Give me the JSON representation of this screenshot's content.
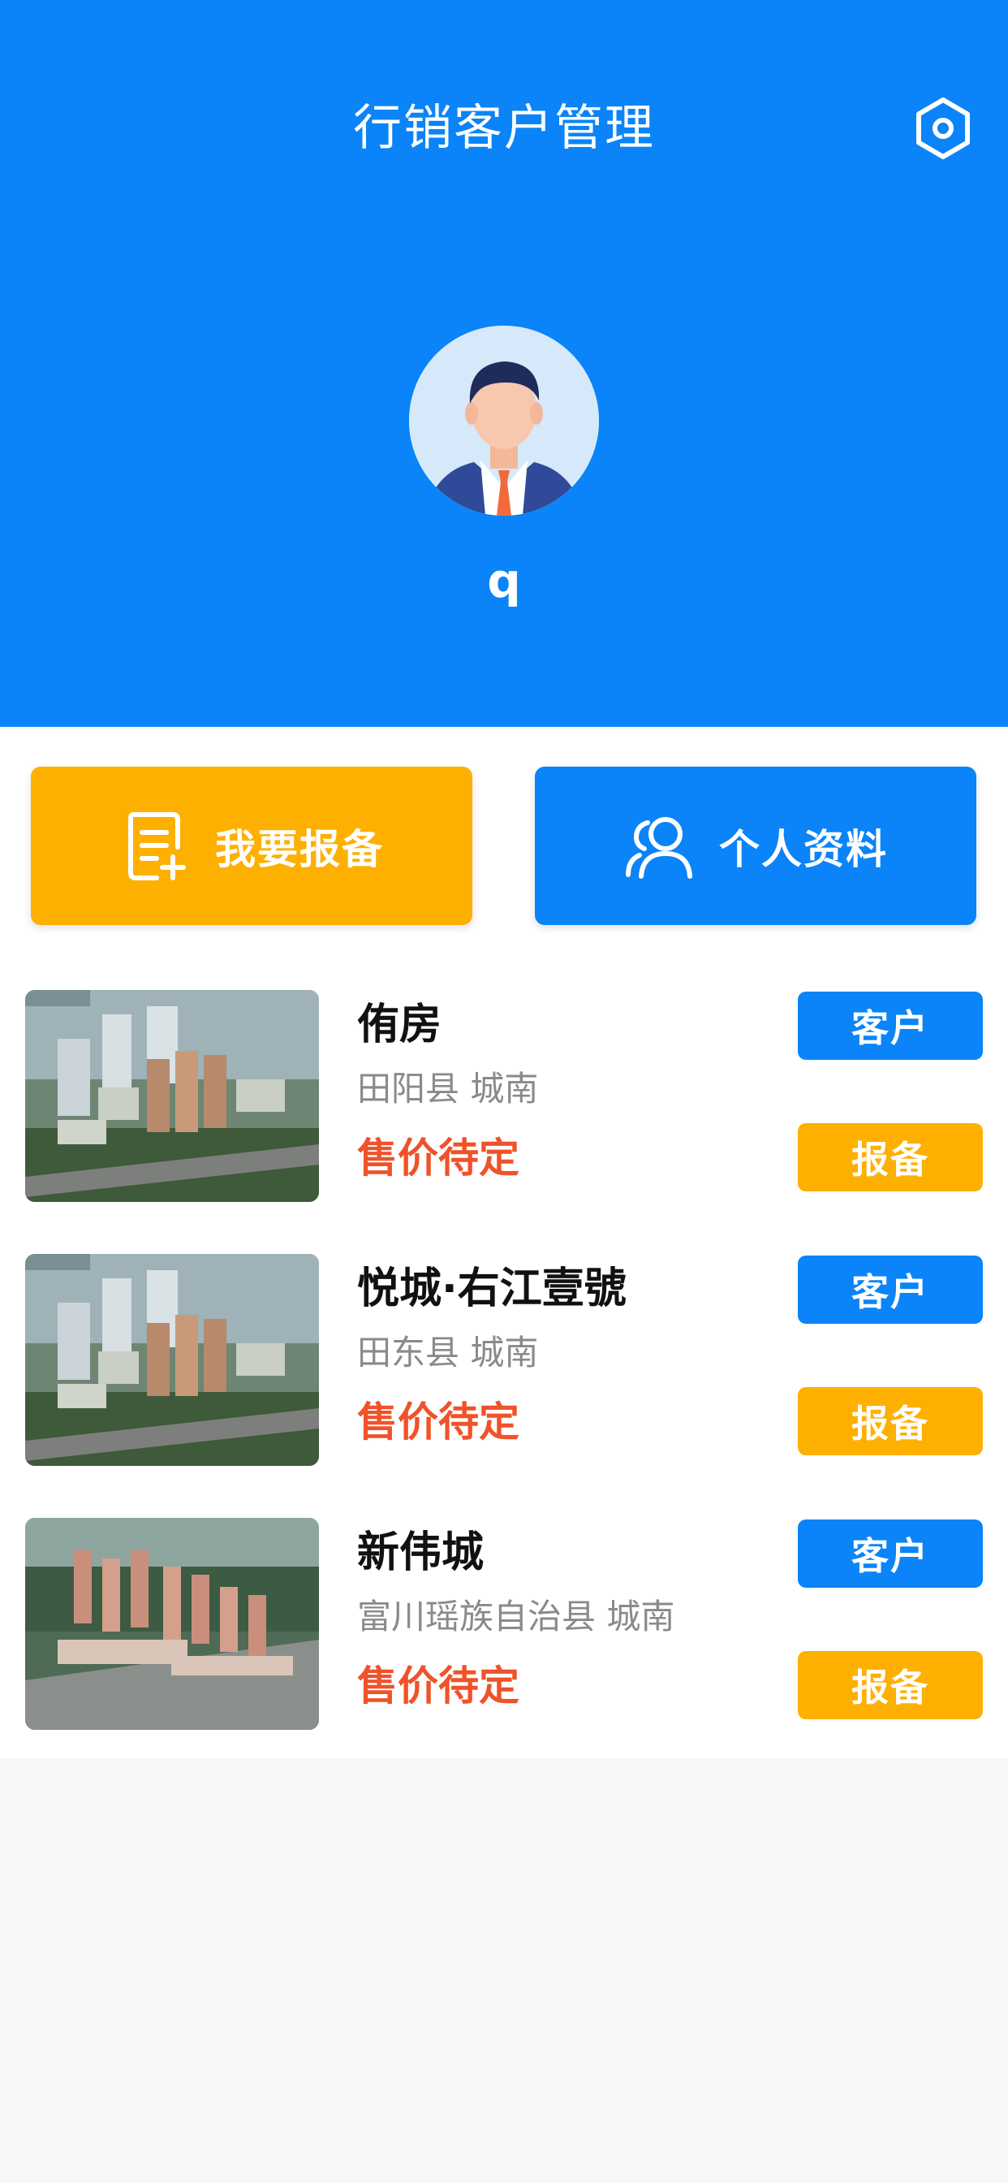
{
  "header": {
    "title": "行销客户管理",
    "settings_icon": "settings-icon",
    "username": "q",
    "background": "#0a84f8"
  },
  "actions": {
    "report": {
      "label": "我要报备",
      "icon": "document-add-icon",
      "color": "#feb000"
    },
    "profile": {
      "label": "个人资料",
      "icon": "users-icon",
      "color": "#0a84f8"
    }
  },
  "projects": [
    {
      "name": "侑房",
      "location": "田阳县 城南",
      "price": "售价待定",
      "customer_label": "客户",
      "report_label": "报备"
    },
    {
      "name": "悦城·右江壹號",
      "location": "田东县 城南",
      "price": "售价待定",
      "customer_label": "客户",
      "report_label": "报备"
    },
    {
      "name": "新伟城",
      "location": "富川瑶族自治县 城南",
      "price": "售价待定",
      "customer_label": "客户",
      "report_label": "报备"
    }
  ],
  "colors": {
    "primary_blue": "#0a84f8",
    "accent_orange": "#feb000",
    "price_red": "#f0522a"
  }
}
